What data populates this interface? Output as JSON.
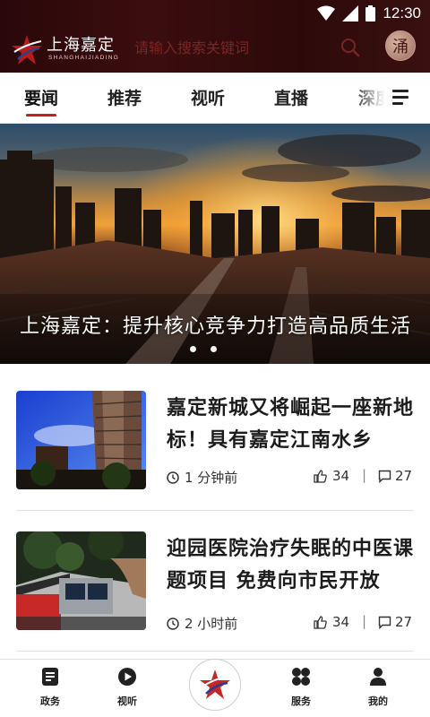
{
  "status_bar": {
    "time": "12:30"
  },
  "header": {
    "logo_text": "上海嘉定",
    "logo_subtext": "SHANGHAIJIADING",
    "search_placeholder": "请输入搜索关键词",
    "avatar_glyph": "涌"
  },
  "tabs": [
    {
      "label": "要闻",
      "active": true
    },
    {
      "label": "推荐",
      "active": false
    },
    {
      "label": "视听",
      "active": false
    },
    {
      "label": "直播",
      "active": false
    },
    {
      "label": "深度",
      "active": false
    }
  ],
  "banner": {
    "caption": "上海嘉定：提升核心竞争力打造高品质生活",
    "slide_count": 2,
    "active_slide": 1
  },
  "articles": [
    {
      "title": "嘉定新城又将崛起一座新地标！具有嘉定江南水乡",
      "time": "1 分钟前",
      "likes": "34",
      "comments": "27"
    },
    {
      "title": "迎园医院治疗失眠的中医课题项目 免费向市民开放",
      "time": "2 小时前",
      "likes": "34",
      "comments": "27"
    }
  ],
  "bottom_nav": [
    {
      "label": "政务",
      "icon": "document-icon"
    },
    {
      "label": "视听",
      "icon": "play-icon"
    },
    {
      "label": "",
      "icon": "logo-icon"
    },
    {
      "label": "服务",
      "icon": "grid-icon"
    },
    {
      "label": "我的",
      "icon": "person-icon"
    }
  ],
  "colors": {
    "header_bg": "#3b0d0e",
    "accent": "#c41e1e"
  }
}
